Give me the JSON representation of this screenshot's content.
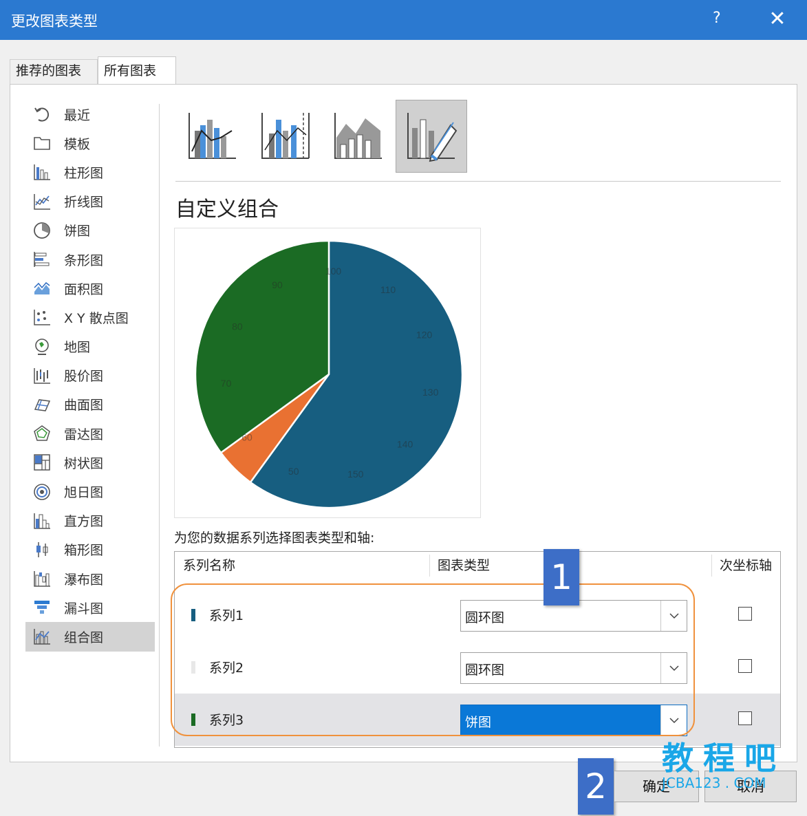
{
  "window": {
    "title": "更改图表类型",
    "help": "?",
    "close": "✕"
  },
  "tabs": [
    {
      "label": "推荐的图表"
    },
    {
      "label": "所有图表"
    }
  ],
  "nav": [
    {
      "label": "最近",
      "icon": "recent-icon"
    },
    {
      "label": "模板",
      "icon": "template-icon"
    },
    {
      "label": "柱形图",
      "icon": "column-chart-icon"
    },
    {
      "label": "折线图",
      "icon": "line-chart-icon"
    },
    {
      "label": "饼图",
      "icon": "pie-chart-icon"
    },
    {
      "label": "条形图",
      "icon": "bar-chart-icon"
    },
    {
      "label": "面积图",
      "icon": "area-chart-icon"
    },
    {
      "label": "X Y 散点图",
      "icon": "scatter-chart-icon"
    },
    {
      "label": "地图",
      "icon": "map-chart-icon"
    },
    {
      "label": "股价图",
      "icon": "stock-chart-icon"
    },
    {
      "label": "曲面图",
      "icon": "surface-chart-icon"
    },
    {
      "label": "雷达图",
      "icon": "radar-chart-icon"
    },
    {
      "label": "树状图",
      "icon": "treemap-chart-icon"
    },
    {
      "label": "旭日图",
      "icon": "sunburst-chart-icon"
    },
    {
      "label": "直方图",
      "icon": "histogram-chart-icon"
    },
    {
      "label": "箱形图",
      "icon": "box-whisker-chart-icon"
    },
    {
      "label": "瀑布图",
      "icon": "waterfall-chart-icon"
    },
    {
      "label": "漏斗图",
      "icon": "funnel-chart-icon"
    },
    {
      "label": "组合图",
      "icon": "combo-chart-icon",
      "selected": true
    }
  ],
  "combo_subtypes": [
    {
      "icon": "clustered-column-line-icon"
    },
    {
      "icon": "clustered-column-line-secondary-axis-icon"
    },
    {
      "icon": "stacked-area-clustered-column-icon"
    },
    {
      "icon": "custom-combination-icon",
      "selected": true
    }
  ],
  "heading": "自定义组合",
  "chart_data": {
    "type": "pie",
    "title": "",
    "slices": [
      {
        "value": 60,
        "color": "#175e80"
      },
      {
        "value": 5,
        "color": "#e97132"
      },
      {
        "value": 35,
        "color": "#1b6b24"
      }
    ],
    "data_labels": [
      "50",
      "60",
      "70",
      "80",
      "90",
      "100",
      "110",
      "120",
      "130",
      "140",
      "150"
    ]
  },
  "series_section": {
    "caption": "为您的数据系列选择图表类型和轴:",
    "headers": {
      "name": "系列名称",
      "type": "图表类型",
      "secondary": "次坐标轴"
    },
    "rows": [
      {
        "name": "系列1",
        "type": "圆环图",
        "color": "#175e80",
        "secondary": false
      },
      {
        "name": "系列2",
        "type": "圆环图",
        "color": "#e8e8e8",
        "secondary": false
      },
      {
        "name": "系列3",
        "type": "饼图",
        "color": "#1b6b24",
        "secondary": false
      }
    ]
  },
  "markers": [
    "1",
    "2"
  ],
  "buttons": {
    "ok": "确定",
    "cancel": "取消"
  },
  "watermark": {
    "text": "教程吧",
    "url": "JCBA123 . COM"
  }
}
